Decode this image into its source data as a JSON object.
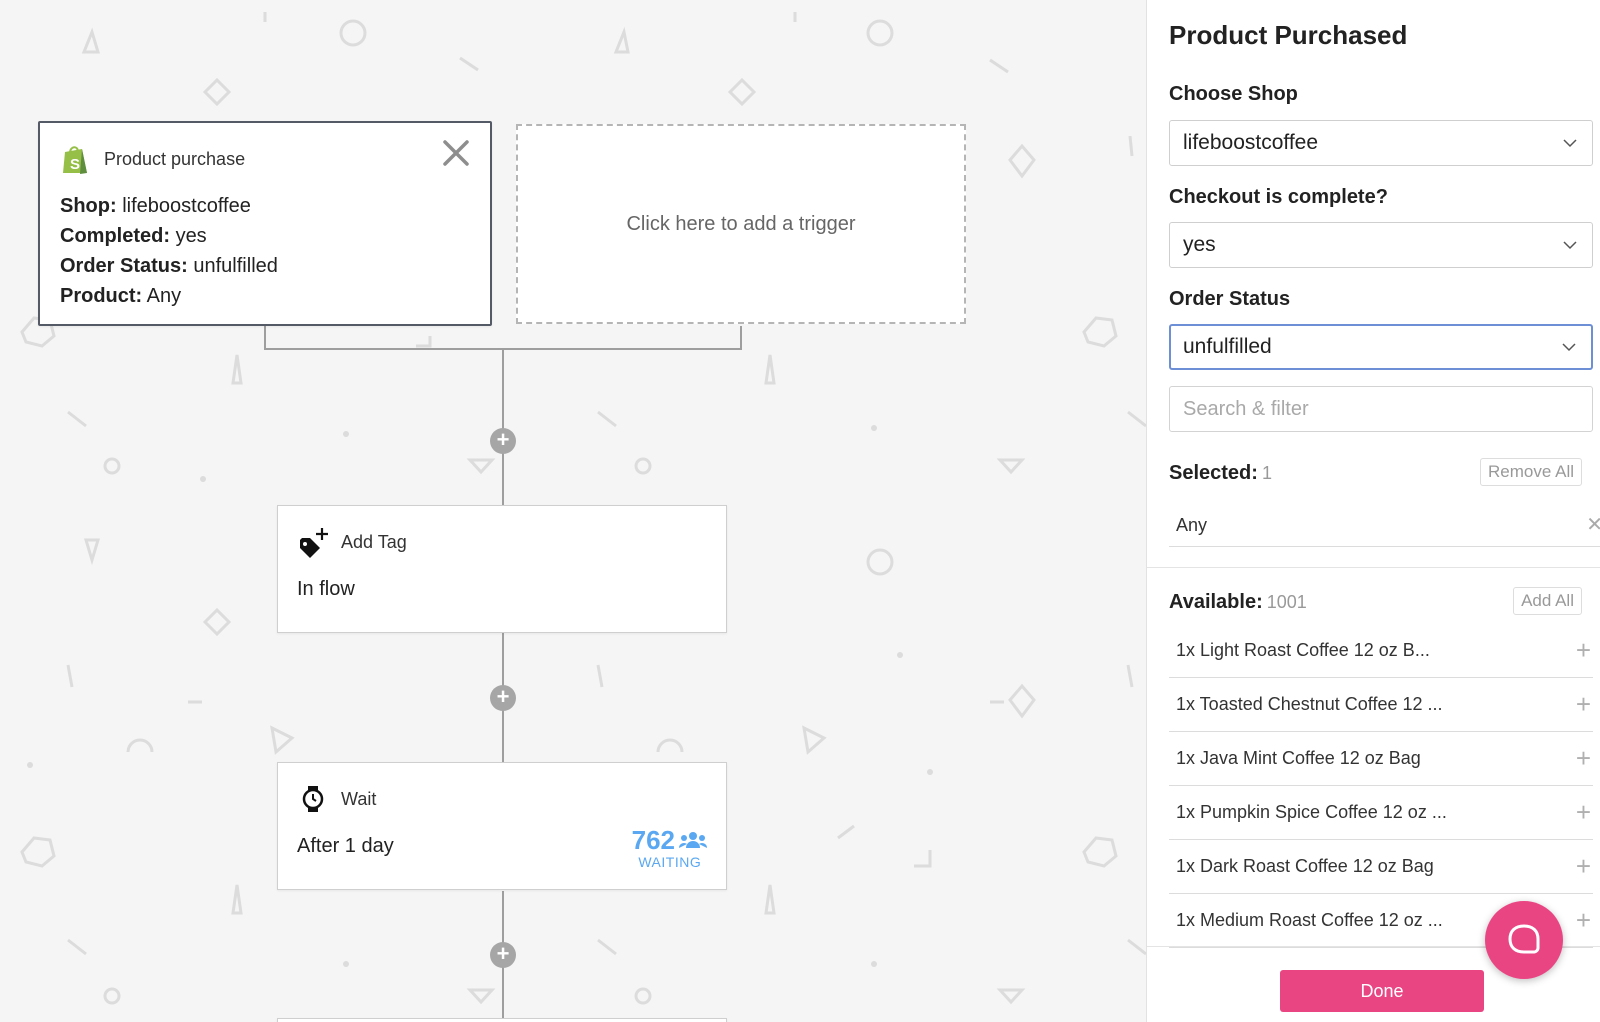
{
  "flow": {
    "trigger": {
      "title": "Product purchase",
      "props": [
        {
          "label": "Shop:",
          "value": "lifeboostcoffee"
        },
        {
          "label": "Completed:",
          "value": "yes"
        },
        {
          "label": "Order Status:",
          "value": "unfulfilled"
        },
        {
          "label": "Product:",
          "value": "Any"
        }
      ]
    },
    "add_trigger_label": "Click here to add a trigger",
    "steps": [
      {
        "icon": "tag-add-icon",
        "title": "Add Tag",
        "detail": "In flow"
      },
      {
        "icon": "stopwatch-icon",
        "title": "Wait",
        "detail": "After 1 day",
        "waiting_count": "762",
        "waiting_label": "WAITING"
      }
    ]
  },
  "panel": {
    "title": "Product Purchased",
    "shop": {
      "label": "Choose Shop",
      "value": "lifeboostcoffee"
    },
    "checkout": {
      "label": "Checkout is complete?",
      "value": "yes"
    },
    "order_status": {
      "label": "Order Status",
      "value": "unfulfilled"
    },
    "search_placeholder": "Search & filter",
    "selected": {
      "label": "Selected:",
      "count": "1",
      "remove_all": "Remove All",
      "items": [
        "Any"
      ]
    },
    "available": {
      "label": "Available:",
      "count": "1001",
      "add_all": "Add All",
      "items": [
        "1x Light Roast Coffee 12 oz B...",
        "1x Toasted Chestnut Coffee 12 ...",
        "1x Java Mint Coffee 12 oz Bag",
        "1x Pumpkin Spice Coffee 12 oz ...",
        "1x Dark Roast Coffee 12 oz Bag",
        "1x Medium Roast Coffee 12 oz ..."
      ]
    },
    "done_label": "Done"
  },
  "colors": {
    "accent": "#ea4583",
    "waiting": "#5aa8f2",
    "focus": "#6c8fd6",
    "shopify": "#95bf47"
  }
}
